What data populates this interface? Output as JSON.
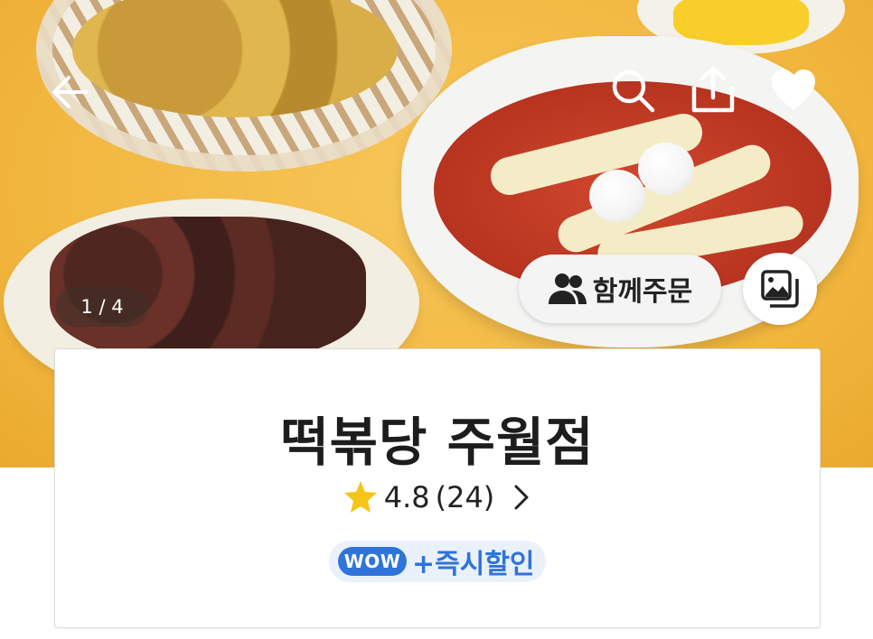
{
  "header": {
    "back_icon": "arrow-left-icon",
    "search_icon": "search-icon",
    "share_icon": "share-icon",
    "favorite_icon": "heart-icon"
  },
  "hero": {
    "image_counter": "1 / 4",
    "group_order_label": "함께주문",
    "group_order_icon": "people-icon",
    "gallery_icon": "photo-gallery-icon"
  },
  "store": {
    "name": "떡볶당 주월점",
    "rating": "4.8",
    "review_count": "(24)",
    "badge_wow": "WOW",
    "badge_text": "+즉시할인"
  },
  "colors": {
    "accent_blue": "#2f74d8",
    "star": "#f5c518",
    "hero_bg": "#f1b53c"
  }
}
